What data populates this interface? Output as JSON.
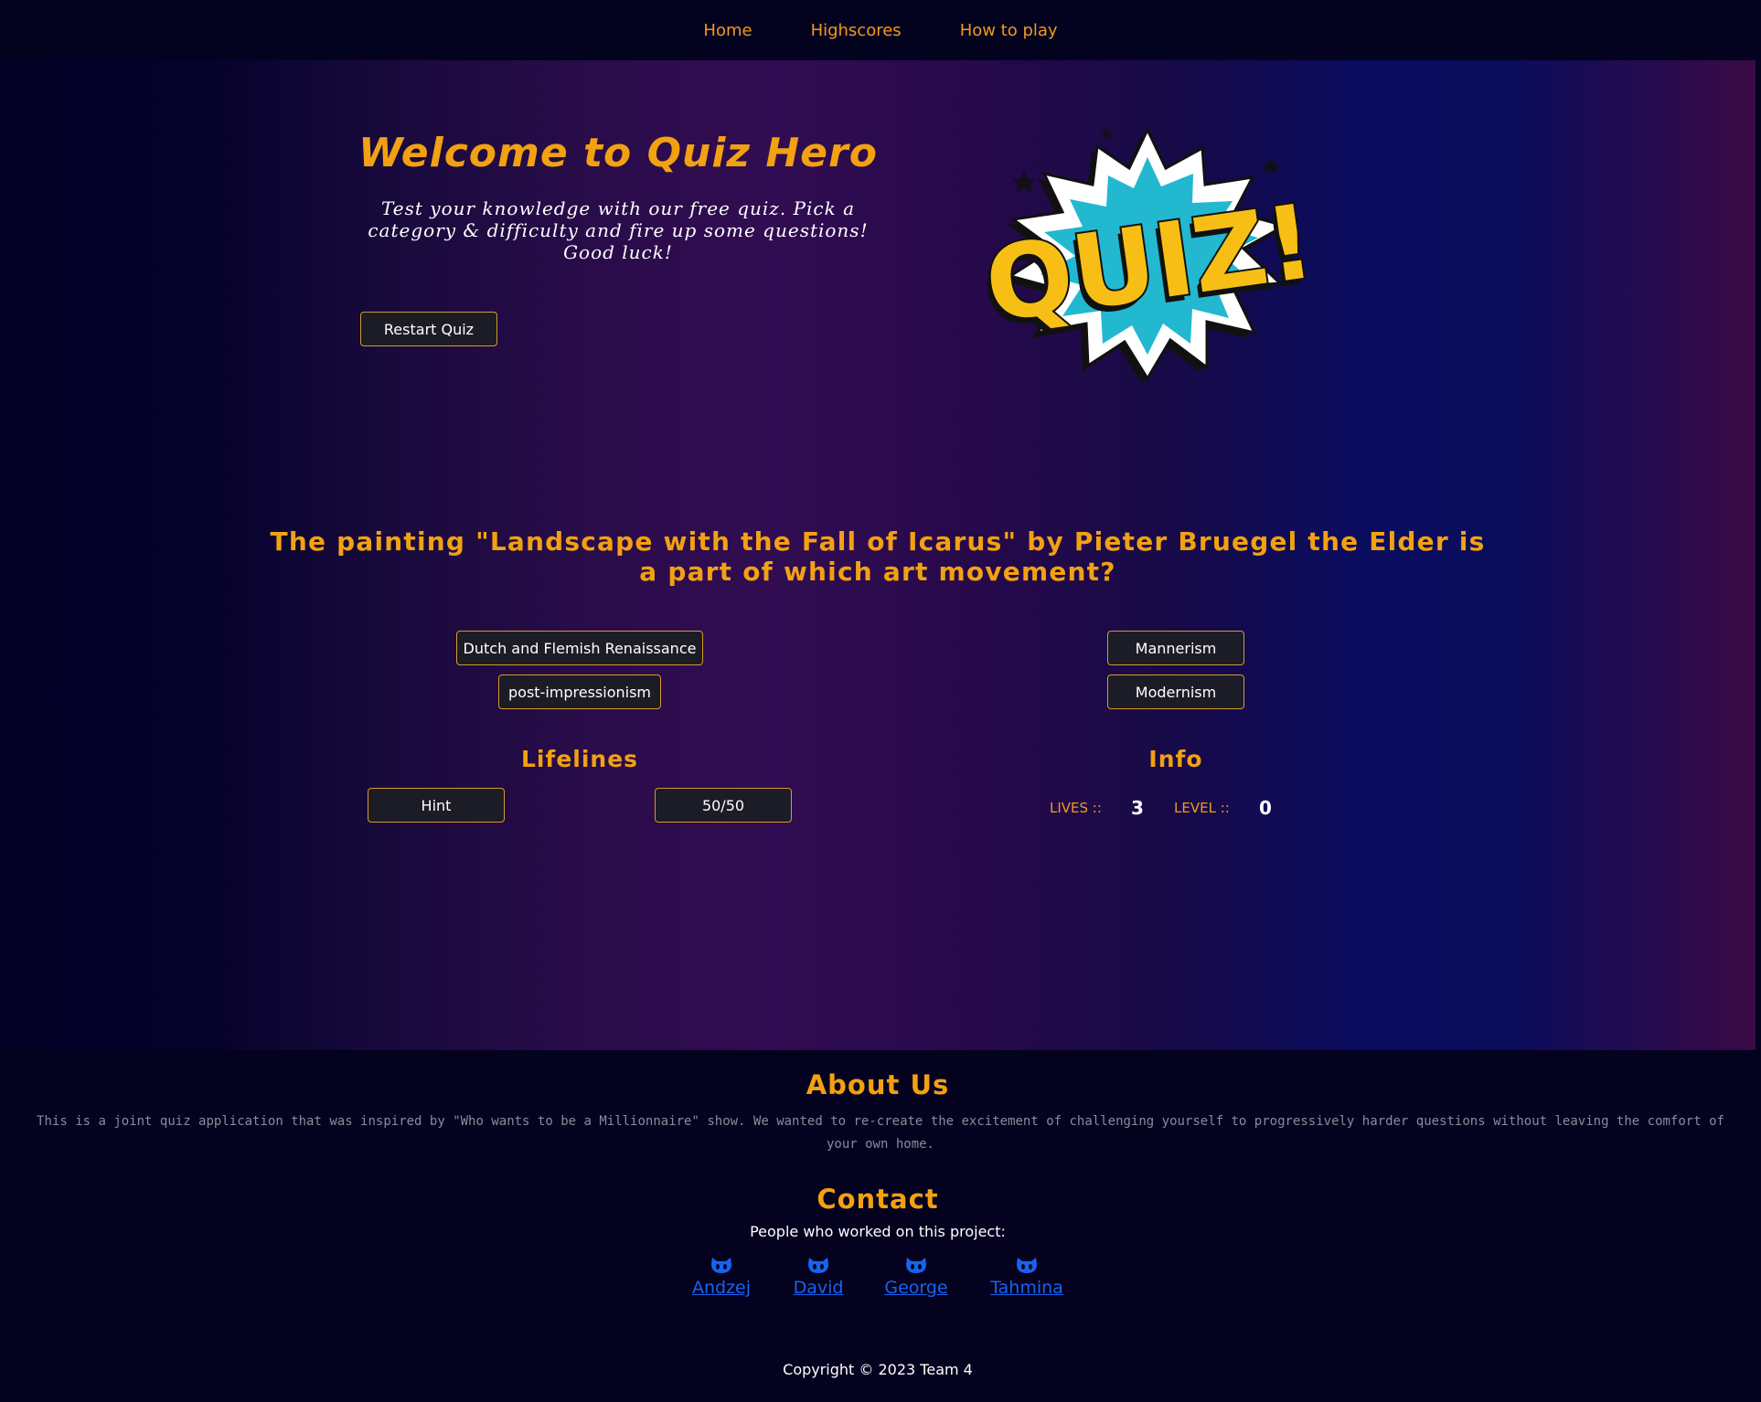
{
  "nav": {
    "items": [
      "Home",
      "Highscores",
      "How to play"
    ]
  },
  "hero": {
    "title": "Welcome to Quiz Hero",
    "text": "Test your knowledge with our free quiz. Pick a category & difficulty and fire up some questions! Good luck!",
    "restart_label": "Restart Quiz",
    "logo_text": "QUIZ!"
  },
  "quiz": {
    "question": "The painting \"Landscape with the Fall of Icarus\" by Pieter Bruegel the Elder is a part of which art movement?",
    "answers": [
      "Dutch and Flemish Renaissance",
      "Mannerism",
      "post-impressionism",
      "Modernism"
    ]
  },
  "lifelines": {
    "title": "Lifelines",
    "hint_label": "Hint",
    "fifty_label": "50/50"
  },
  "info": {
    "title": "Info",
    "lives_label": "LIVES ::",
    "lives_value": "3",
    "level_label": "LEVEL ::",
    "level_value": "0"
  },
  "about": {
    "title": "About Us",
    "text": "This is a joint quiz application that was inspired by \"Who wants to be a Millionnaire\" show. We wanted to re-create the excitement of challenging yourself to progressively harder questions without leaving the comfort of your own home."
  },
  "contact": {
    "title": "Contact",
    "text": "People who worked on this project:",
    "people": [
      "Andzej",
      "David",
      "George",
      "Tahmina"
    ]
  },
  "footer": {
    "copyright": "Copyright © 2023 Team 4"
  },
  "colors": {
    "accent": "#f2a112",
    "button_border": "#d49a2a",
    "link": "#1763f0",
    "background": "#04021f"
  },
  "icons": {
    "contributor_icon": "github-icon"
  }
}
